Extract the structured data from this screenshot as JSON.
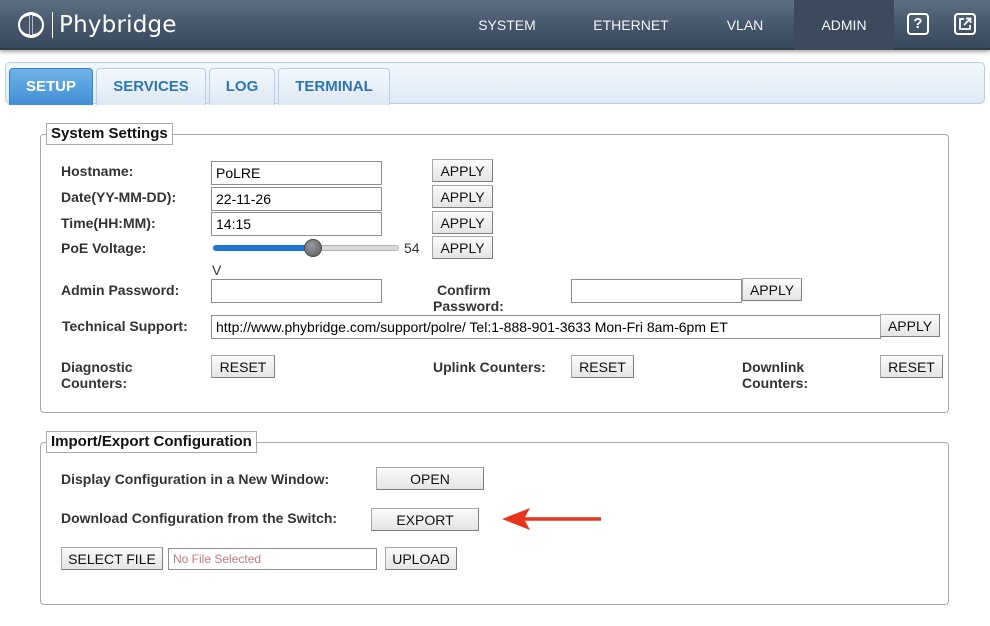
{
  "brand": {
    "name": "Phybridge",
    "logo_icon": "phybridge-logo-icon"
  },
  "nav": {
    "items": [
      {
        "label": "SYSTEM"
      },
      {
        "label": "ETHERNET"
      },
      {
        "label": "VLAN"
      },
      {
        "label": "ADMIN",
        "active": true
      }
    ],
    "help_icon": "help-icon",
    "help_glyph": "?",
    "popout_icon": "external-window-icon"
  },
  "tabs": [
    {
      "label": "SETUP",
      "active": true
    },
    {
      "label": "SERVICES"
    },
    {
      "label": "LOG"
    },
    {
      "label": "TERMINAL"
    }
  ],
  "system_settings": {
    "title": "System Settings",
    "hostname": {
      "label": "Hostname:",
      "value": "PoLRE",
      "apply": "APPLY"
    },
    "date": {
      "label": "Date(YY-MM-DD):",
      "value": "22-11-26",
      "apply": "APPLY"
    },
    "time": {
      "label": "Time(HH:MM):",
      "value": "14:15",
      "apply": "APPLY"
    },
    "poe": {
      "label": "PoE Voltage:",
      "value": "54",
      "unit": "V",
      "min": 0,
      "max": 100,
      "level": 0.54,
      "apply": "APPLY"
    },
    "admin_password": {
      "label": "Admin Password:",
      "value": "",
      "apply": "APPLY"
    },
    "confirm_password": {
      "label_line1": "Confirm",
      "label_line2": "Password:",
      "value": ""
    },
    "tech_support": {
      "label": "Technical Support:",
      "value": "http://www.phybridge.com/support/polre/ Tel:1-888-901-3633 Mon-Fri 8am-6pm ET",
      "apply": "APPLY"
    },
    "diagnostic": {
      "label_line1": "Diagnostic",
      "label_line2": "Counters:",
      "button": "RESET"
    },
    "uplink": {
      "label": "Uplink Counters:",
      "button": "RESET"
    },
    "downlink": {
      "label_line1": "Downlink",
      "label_line2": "Counters:",
      "button": "RESET"
    }
  },
  "import_export": {
    "title": "Import/Export Configuration",
    "display": {
      "label": "Display Configuration in a New Window:",
      "button": "OPEN"
    },
    "download": {
      "label": "Download Configuration from the Switch:",
      "button": "EXPORT"
    },
    "upload": {
      "select_button": "SELECT FILE",
      "file_placeholder": "No File Selected",
      "upload_button": "UPLOAD"
    },
    "arrow_color": "#e8341c"
  },
  "colors": {
    "header_bg": "#45566a",
    "tab_active": "#3f8fd3",
    "tab_text": "#2e76b2",
    "slider_fill": "#1e78d2"
  }
}
